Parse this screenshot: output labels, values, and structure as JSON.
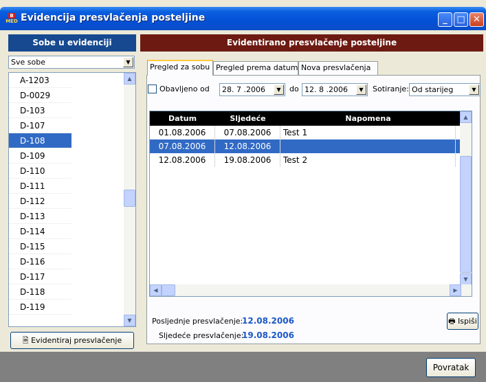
{
  "window": {
    "title": "Evidencija presvlačenja posteljine",
    "icon_top": "B",
    "icon_bottom": "MED",
    "controls": {
      "minimize": "_",
      "maximize": "□",
      "close": "✕"
    }
  },
  "left_panel": {
    "header": "Sobe u evidenciji",
    "filter": {
      "value": "Sve sobe"
    },
    "rooms": [
      "A-1203",
      "D-0029",
      "D-103",
      "D-107",
      "D-108",
      "D-109",
      "D-110",
      "D-111",
      "D-112",
      "D-113",
      "D-114",
      "D-115",
      "D-116",
      "D-117",
      "D-118",
      "D-119"
    ],
    "selected_room": "D-108",
    "action_button": "Evidentiraj presvlačenje"
  },
  "right_panel": {
    "header": "Evidentirano presvlačenje posteljine",
    "tabs": [
      {
        "label": "Pregled za sobu",
        "active": true
      },
      {
        "label": "Pregled prema datumu",
        "active": false
      },
      {
        "label": "Nova presvlačenja",
        "active": false
      }
    ],
    "filter": {
      "checkbox_label": "Obavljeno od",
      "date_from": "28. 7 .2006",
      "to_label": "do",
      "date_to": "12. 8 .2006",
      "sort_label": "Sotiranje:",
      "sort_value": "Od starijeg"
    },
    "grid": {
      "columns": [
        "Datum",
        "Sljedeće",
        "Napomena"
      ],
      "rows": [
        [
          "01.08.2006",
          "07.08.2006",
          "Test 1"
        ],
        [
          "07.08.2006",
          "12.08.2006",
          ""
        ],
        [
          "12.08.2006",
          "19.08.2006",
          "Test 2"
        ]
      ],
      "selected_row": 1
    },
    "summary": {
      "last_label": "Posljednje presvlačenje:",
      "last_value": "12.08.2006",
      "next_label": "Sljedeće presvlačenje:",
      "next_value": "19.08.2006"
    },
    "print_button": "Ispiši"
  },
  "footer": {
    "back_button": "Povratak"
  },
  "colors": {
    "left_header": "#16498f",
    "right_header": "#6d1a12",
    "selection": "#316ac5",
    "summary_value": "#1c57c8"
  }
}
